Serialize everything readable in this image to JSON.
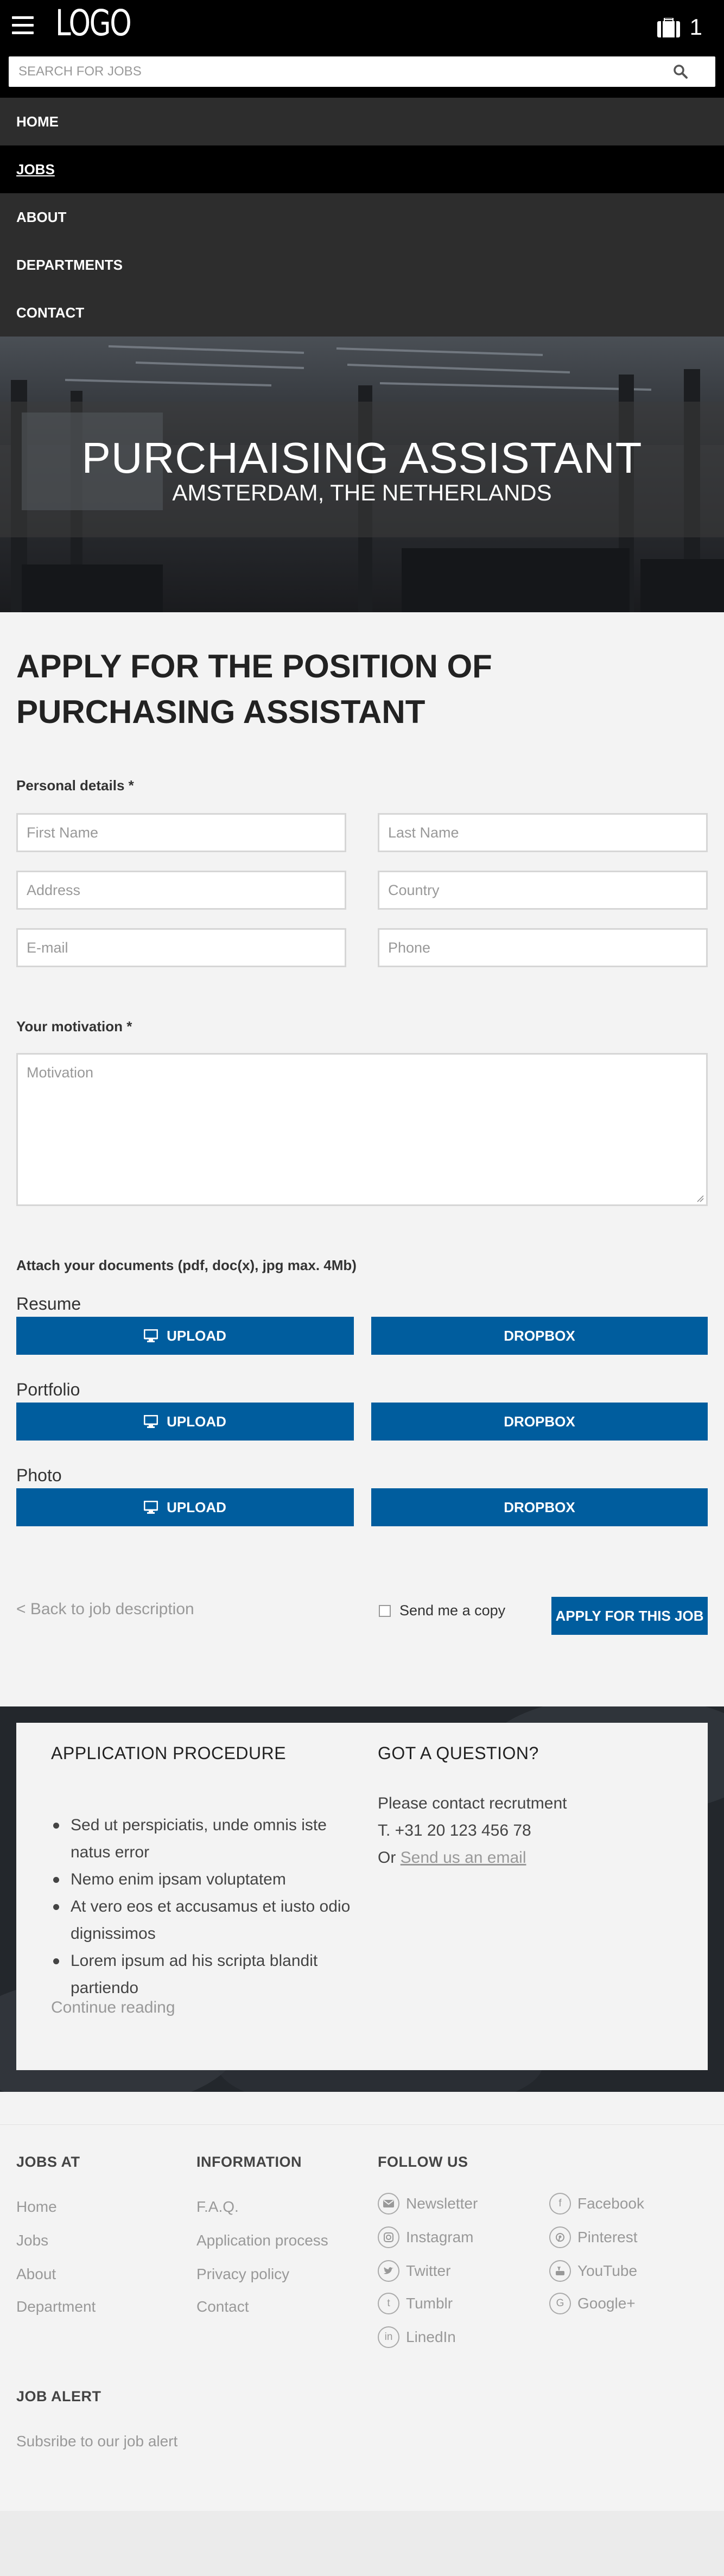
{
  "header": {
    "logo": "LOGO",
    "cart_count": "1",
    "search_placeholder": "SEARCH FOR JOBS"
  },
  "nav": {
    "items": [
      {
        "label": "HOME"
      },
      {
        "label": "JOBS"
      },
      {
        "label": "ABOUT"
      },
      {
        "label": "DEPARTMENTS"
      },
      {
        "label": "CONTACT"
      }
    ]
  },
  "hero": {
    "title": "PURCHAISING ASSISTANT",
    "location": "AMSTERDAM, THE NETHERLANDS"
  },
  "form": {
    "title": "APPLY FOR THE POSITION OF PURCHASING ASSISTANT",
    "personal_label": "Personal details *",
    "first_name_placeholder": "First Name",
    "last_name_placeholder": "Last Name",
    "address_placeholder": "Address",
    "country_placeholder": "Country",
    "email_placeholder": "E-mail",
    "phone_placeholder": "Phone",
    "motivation_label": "Your motivation *",
    "motivation_placeholder": "Motivation",
    "attach_label": "Attach your documents (pdf, doc(x), jpg max. 4Mb)",
    "documents": [
      {
        "label": "Resume",
        "upload": "UPLOAD",
        "dropbox": "DROPBOX"
      },
      {
        "label": "Portfolio",
        "upload": "UPLOAD",
        "dropbox": "DROPBOX"
      },
      {
        "label": "Photo",
        "upload": "UPLOAD",
        "dropbox": "DROPBOX"
      }
    ],
    "back_link": "< Back to job description",
    "send_copy_label": "Send me a copy",
    "apply_button": "APPLY FOR THIS JOB"
  },
  "info": {
    "procedure_title": "APPLICATION PROCEDURE",
    "procedure_items": [
      "Sed ut perspiciatis, unde omnis iste natus error",
      "Nemo enim ipsam voluptatem",
      "At vero eos et accusamus et iusto odio dignissimos",
      "Lorem ipsum ad his scripta blandit partiendo"
    ],
    "continue_reading": "Continue reading",
    "question_title": "GOT A QUESTION?",
    "contact_line1": "Please contact recrutment",
    "contact_phone": "T. +31 20 123 456 78",
    "contact_or": "Or",
    "contact_email_link": "Send us an email"
  },
  "footer": {
    "jobs_at": {
      "title": "JOBS AT",
      "links": [
        "Home",
        "Jobs",
        "About",
        "Department"
      ]
    },
    "information": {
      "title": "INFORMATION",
      "links": [
        "F.A.Q.",
        "Application process",
        "Privacy policy",
        "Contact"
      ]
    },
    "follow_us": {
      "title": "FOLLOW US",
      "left": [
        {
          "label": "Newsletter",
          "icon": "envelope-icon"
        },
        {
          "label": "Instagram",
          "icon": "instagram-icon"
        },
        {
          "label": "Twitter",
          "icon": "twitter-icon"
        },
        {
          "label": "Tumblr",
          "icon": "tumblr-icon",
          "glyph": "t"
        },
        {
          "label": "LinedIn",
          "icon": "linkedin-icon",
          "glyph": "in"
        }
      ],
      "right": [
        {
          "label": "Facebook",
          "icon": "facebook-icon",
          "glyph": "f"
        },
        {
          "label": "Pinterest",
          "icon": "pinterest-icon"
        },
        {
          "label": "YouTube",
          "icon": "youtube-icon"
        },
        {
          "label": "Google+",
          "icon": "google-plus-icon",
          "glyph": "G"
        }
      ]
    },
    "job_alert": {
      "title": "JOB ALERT",
      "link": "Subsribe to our job alert"
    }
  },
  "colors": {
    "primary_blue": "#005d9e",
    "nav_bg": "#2d2d2d",
    "header_bg": "#000000",
    "page_bg": "#f3f3f3"
  }
}
